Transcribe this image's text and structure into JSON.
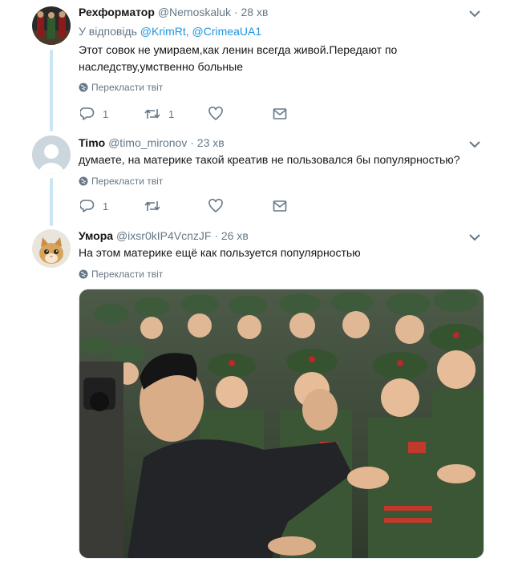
{
  "tweets": [
    {
      "name": "Рехформатор",
      "handle": "@Nemoskaluk",
      "time": "28 хв",
      "reply_prefix": "У відповідь",
      "reply_user1": "@KrimRt,",
      "reply_user2": "@CrimeaUA1",
      "text": "Этот совок не умираем,как ленин всегда живой.Передают по наследству,умственно больные",
      "translate": "Перекласти твіт",
      "replies": "1",
      "retweets": "1"
    },
    {
      "name": "Timo",
      "handle": "@timo_mironov",
      "time": "23 хв",
      "text": "думаете, на материке такой креатив не пользовался бы популярностью?",
      "translate": "Перекласти твіт",
      "replies": "1"
    },
    {
      "name": "Умора",
      "handle": "@ixsr0kIP4VcnzJF",
      "time": "26 хв",
      "text": "На этом материке ещё как пользуется популярностью",
      "translate": "Перекласти твіт"
    }
  ],
  "separator": "·",
  "colors": {
    "text": "#14171a",
    "secondary": "#657786",
    "link": "#1b95e0",
    "thread": "#cce5f4"
  }
}
